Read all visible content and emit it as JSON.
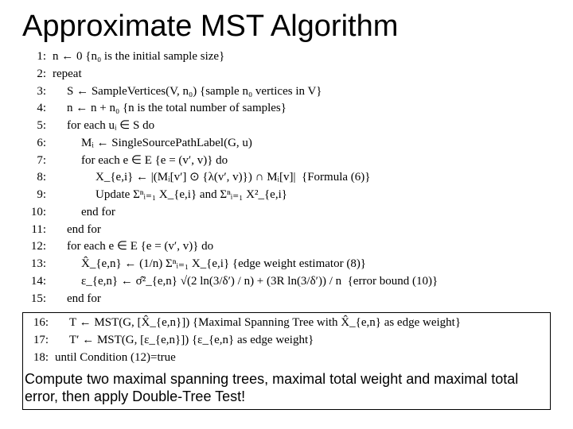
{
  "title": "Approximate MST Algorithm",
  "lines": [
    {
      "n": "1:",
      "indent": 0,
      "text": "n ← 0 {n₀ is the initial sample size}"
    },
    {
      "n": "2:",
      "indent": 0,
      "text": "repeat"
    },
    {
      "n": "3:",
      "indent": 1,
      "text": "S ← SampleVertices(V, n₀) {sample n₀ vertices in V}"
    },
    {
      "n": "4:",
      "indent": 1,
      "text": "n ← n + n₀ {n is the total number of samples}"
    },
    {
      "n": "5:",
      "indent": 1,
      "text": "for each uᵢ ∈ S do"
    },
    {
      "n": "6:",
      "indent": 2,
      "text": "Mᵢ ← SingleSourcePathLabel(G, u)"
    },
    {
      "n": "7:",
      "indent": 2,
      "text": "for each e ∈ E {e = (v′, v)} do"
    },
    {
      "n": "8:",
      "indent": 3,
      "text": "X_{e,i} ← |(Mᵢ[v′] ⊙ {λ(v′, v)}) ∩ Mᵢ[v]|  {Formula (6)}"
    },
    {
      "n": "9:",
      "indent": 3,
      "text": "Update Σⁿᵢ₌₁ X_{e,i} and Σⁿᵢ₌₁ X²_{e,i}"
    },
    {
      "n": "10:",
      "indent": 2,
      "text": "end for"
    },
    {
      "n": "11:",
      "indent": 1,
      "text": "end for"
    },
    {
      "n": "12:",
      "indent": 1,
      "text": "for each e ∈ E {e = (v′, v)} do"
    },
    {
      "n": "13:",
      "indent": 2,
      "text": "X̂_{e,n} ← (1/n) Σⁿᵢ₌₁ X_{e,i} {edge weight estimator (8)}"
    },
    {
      "n": "14:",
      "indent": 2,
      "text": "ε_{e,n} ← σ̂²_{e,n} √(2 ln(3/δ′) / n) + (3R ln(3/δ′)) / n  {error bound (10)}"
    },
    {
      "n": "15:",
      "indent": 1,
      "text": "end for"
    }
  ],
  "boxed_lines": [
    {
      "n": "16:",
      "indent": 1,
      "text": "T ← MST(G, [X̂_{e,n}]) {Maximal Spanning Tree with X̂_{e,n} as edge weight}"
    },
    {
      "n": "17:",
      "indent": 1,
      "text": "T′ ← MST(G, [ε_{e,n}]) {ε_{e,n} as edge weight}"
    },
    {
      "n": "18:",
      "indent": 0,
      "text": "until Condition (12)=true"
    }
  ],
  "note": "Compute two maximal spanning trees, maximal total weight and maximal total error, then apply Double-Tree Test!"
}
